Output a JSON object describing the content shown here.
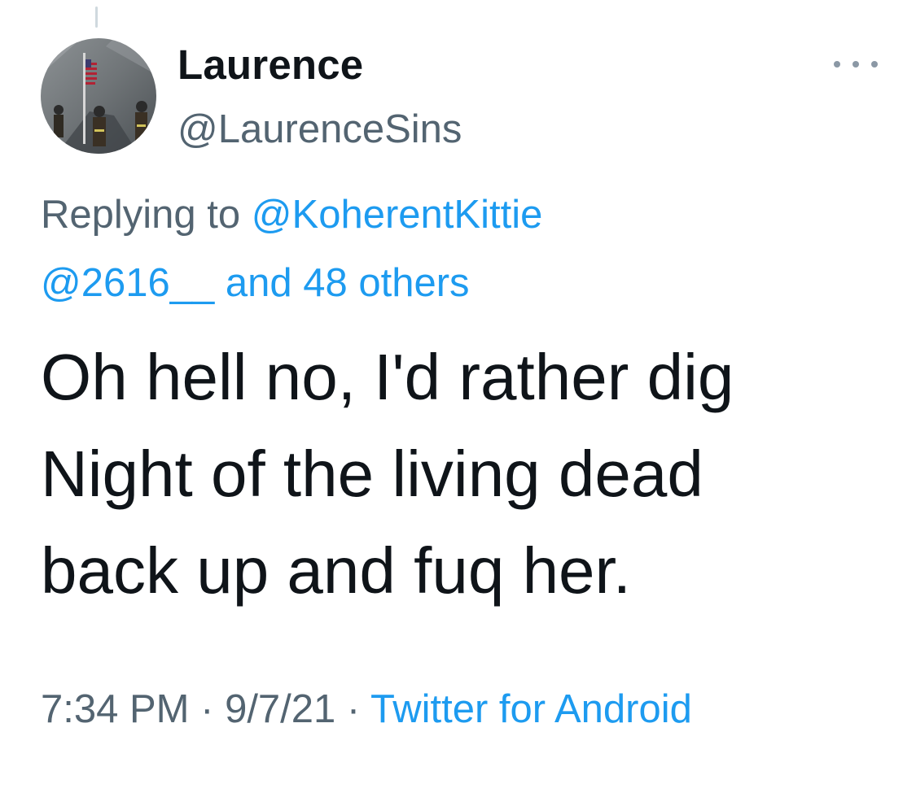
{
  "tweet": {
    "author": {
      "display_name": "Laurence",
      "handle": "@LaurenceSins",
      "avatar_icon": "avatar-photo-icon"
    },
    "more_icon": "more-options-icon",
    "replying": {
      "prefix": "Replying to",
      "first_mention": "@KoherentKittie",
      "second_mention": "@2616__",
      "others": "and 48 others"
    },
    "text": "Oh hell no, I'd rather dig\nNight of the living dead\nback up and fuq her.",
    "meta": {
      "time": "7:34 PM",
      "separator": "·",
      "date": "9/7/21",
      "source": "Twitter for Android"
    }
  },
  "colors": {
    "text_primary": "#0f1419",
    "text_secondary": "#536471",
    "link": "#1d9bf0",
    "thread_line": "#cfd9de"
  }
}
